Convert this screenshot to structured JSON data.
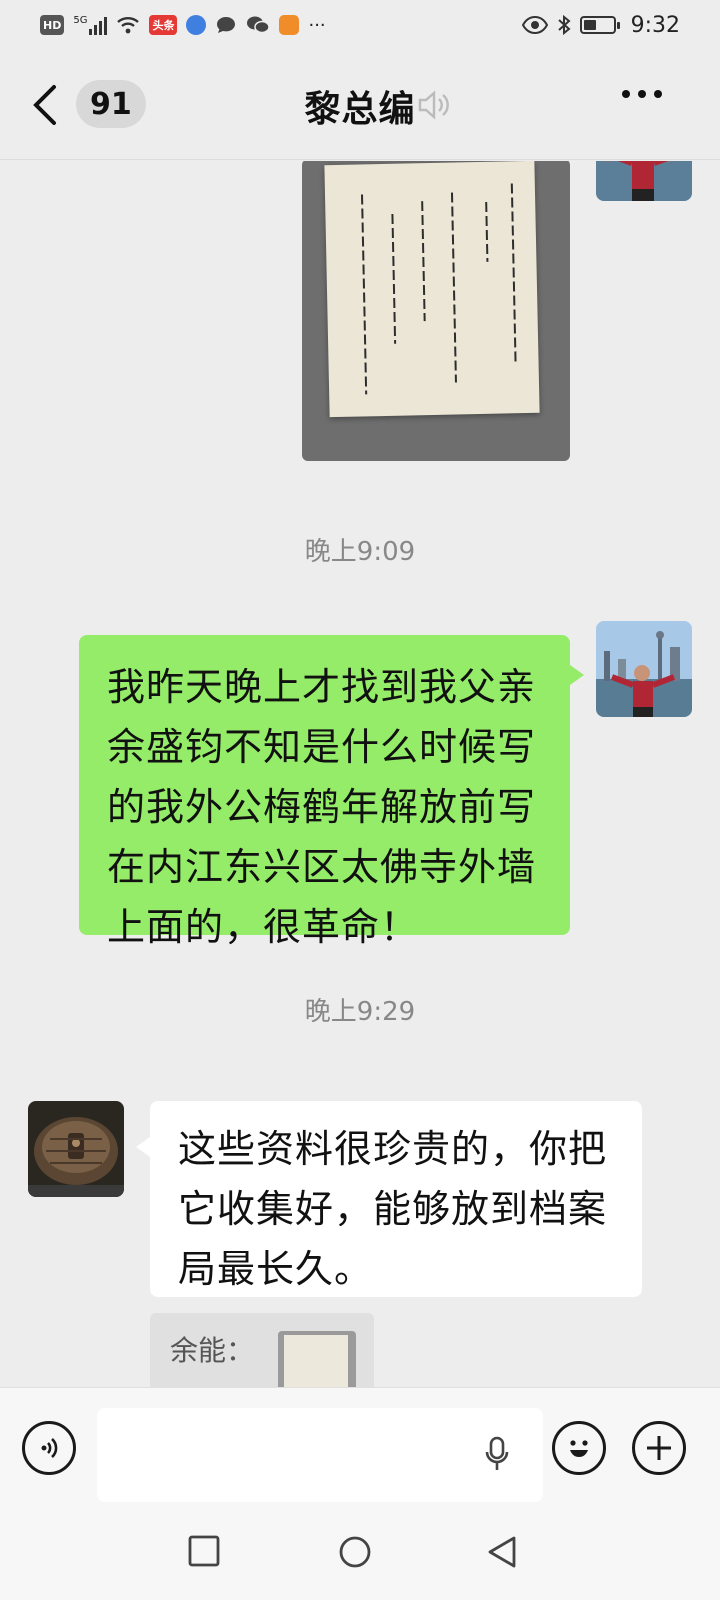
{
  "status_bar": {
    "time": "9:32",
    "network": "5G",
    "hd_label": "HD",
    "news_badge": "头条",
    "more": "···"
  },
  "header": {
    "unread_count": "91",
    "title": "黎总编"
  },
  "messages": [
    {
      "type": "image",
      "sender": "self",
      "caption": ""
    },
    {
      "type": "timestamp",
      "text": "晚上9:09"
    },
    {
      "type": "text",
      "sender": "self",
      "text": "我昨天晚上才找到我父亲余盛钧不知是什么时候写的我外公梅鹤年解放前写在内江东兴区太佛寺外墙上面的，很革命！"
    },
    {
      "type": "timestamp",
      "text": "晚上9:29"
    },
    {
      "type": "text",
      "sender": "other",
      "text": "这些资料很珍贵的，你把它收集好，能够放到档案局最长久。"
    },
    {
      "type": "quote",
      "sender": "other",
      "label": "余能："
    }
  ],
  "input": {
    "placeholder": ""
  },
  "colors": {
    "outgoing_bubble": "#95ec69",
    "incoming_bubble": "#ffffff",
    "background": "#ededed"
  },
  "icons": {
    "back": "chevron-left-icon",
    "mute": "muted-speaker-icon",
    "more": "more-dots-icon",
    "voice": "voice-mode-icon",
    "mic": "microphone-icon",
    "emoji": "emoji-icon",
    "plus": "plus-icon"
  }
}
